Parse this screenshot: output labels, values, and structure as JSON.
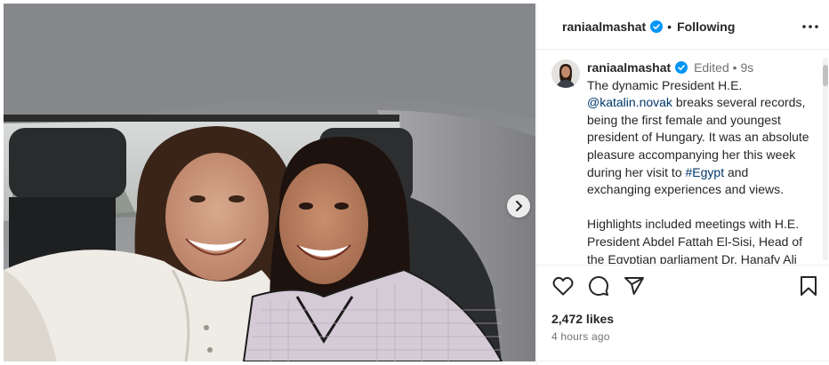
{
  "post": {
    "username": "raniaalmashat",
    "verified_icon": "verified-badge-icon",
    "follow_separator": "•",
    "follow_state": "Following",
    "more_icon": "more-horizontal-icon"
  },
  "caption": {
    "username": "raniaalmashat",
    "edited_label": "Edited",
    "separator": "•",
    "age": "9s",
    "p1_start": "The dynamic President H.E. ",
    "mention": "@katalin.novak",
    "p1_mid": " breaks several records, being the first female and youngest president of Hungary. It was an absolute pleasure accompanying her this week during her visit to ",
    "hashtag": "#Egypt",
    "p1_end": " and exchanging experiences and views.",
    "p2": "Highlights included meetings with H.E. President Abdel Fattah El-Sisi, Head of the Egyptian parliament Dr. Hanafy Ali El-Gebali, Head of Egypt's Coptic"
  },
  "actions": {
    "like_icon": "heart-icon",
    "comment_icon": "comment-icon",
    "share_icon": "share-icon",
    "save_icon": "bookmark-icon",
    "likes": "2,472 likes",
    "posted_time": "4 hours ago"
  },
  "media": {
    "next_icon": "chevron-right-icon"
  },
  "colors": {
    "accent_blue": "#0095f6",
    "link": "#00376b",
    "muted": "#737373",
    "text": "#262626"
  }
}
